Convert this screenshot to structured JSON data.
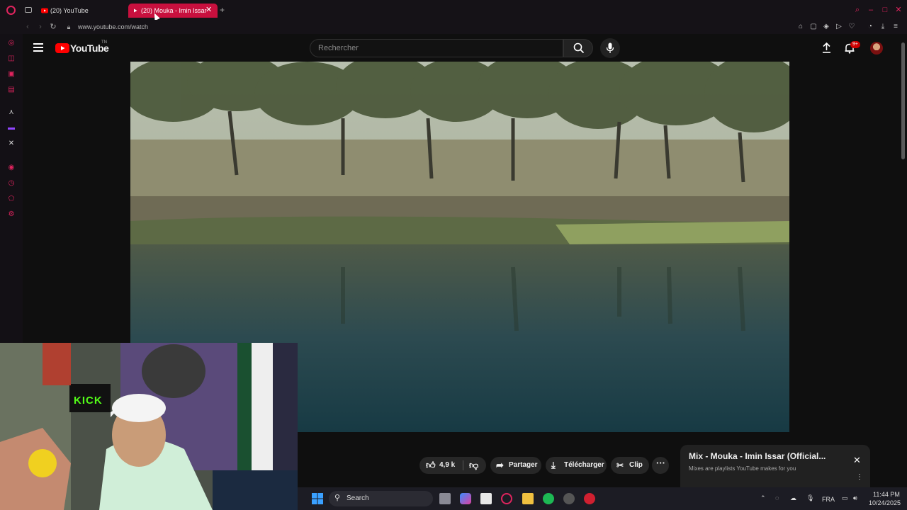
{
  "browser": {
    "tabs": [
      {
        "label": "(20) YouTube",
        "active": false
      },
      {
        "label": "(20) Mouka - Imin Issar",
        "active": true
      }
    ],
    "url": "www.youtube.com/watch",
    "accent": "#e0245e"
  },
  "youtube": {
    "logo_text": "YouTube",
    "logo_suffix": "TN",
    "search_placeholder": "Rechercher",
    "notification_badge": "9+"
  },
  "actions": {
    "like_count": "4,9 k",
    "share_label": "Partager",
    "download_label": "Télécharger",
    "clip_label": "Clip"
  },
  "mix": {
    "title": "Mix - Mouka - Imin Issar (Official...",
    "subtitle": "Mixes are playlists YouTube makes for you"
  },
  "webcam": {
    "sign_text": "KICK"
  },
  "taskbar": {
    "search_label": "Search",
    "language": "FRA",
    "time": "11:44 PM",
    "date": "10/24/2025"
  }
}
